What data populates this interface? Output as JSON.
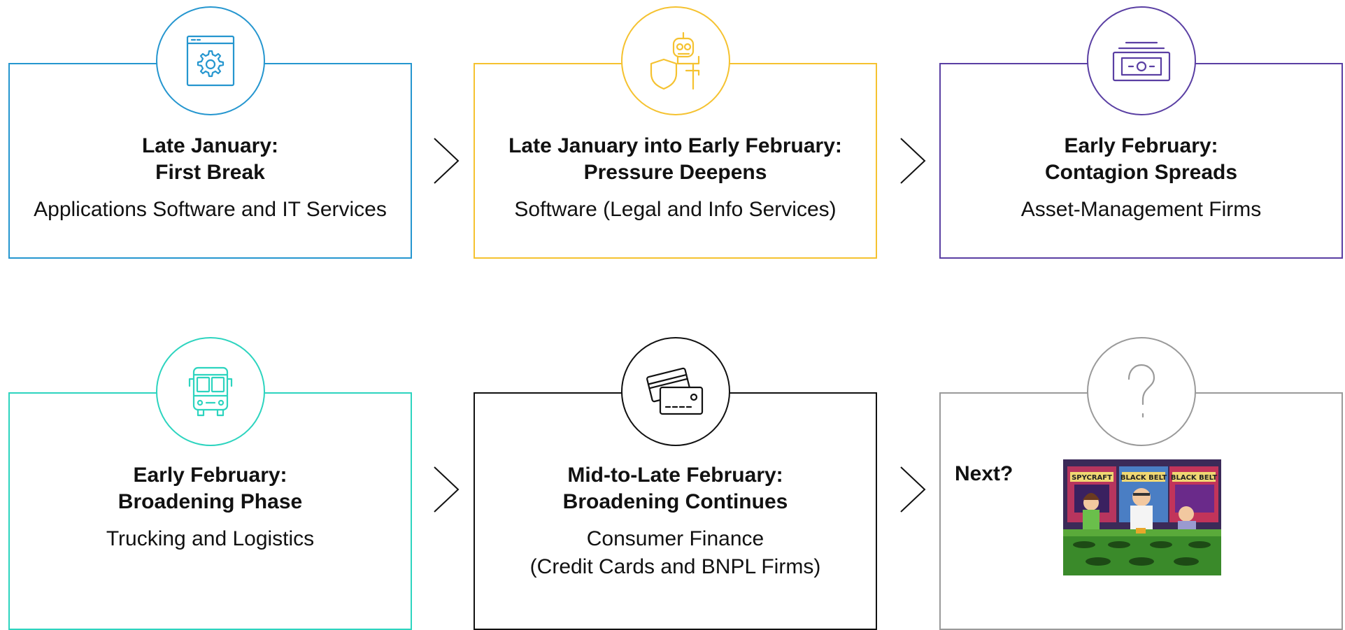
{
  "colors": {
    "blue": "#2596cf",
    "yellow": "#f5c230",
    "purple": "#5a3fa3",
    "teal": "#2dd4bf",
    "black": "#111111",
    "gray": "#9a9a9a"
  },
  "stages": [
    {
      "title_line1": "Late January:",
      "title_line2": "First Break",
      "subtitle": "Applications Software and IT Services",
      "icon": "browser-gear-icon"
    },
    {
      "title_line1": "Late January into Early February:",
      "title_line2": "Pressure Deepens",
      "subtitle": "Software (Legal and Info Services)",
      "icon": "robot-shield-icon"
    },
    {
      "title_line1": "Early February:",
      "title_line2": "Contagion Spreads",
      "subtitle": "Asset-Management Firms",
      "icon": "banknote-stack-icon"
    },
    {
      "title_line1": "Early February:",
      "title_line2": "Broadening Phase",
      "subtitle": "Trucking and Logistics",
      "icon": "bus-icon"
    },
    {
      "title_line1": "Mid-to-Late February:",
      "title_line2": "Broadening Continues",
      "subtitle_line1": "Consumer Finance",
      "subtitle_line2": "(Credit Cards and BNPL Firms)",
      "icon": "credit-cards-icon"
    },
    {
      "label": "Next?",
      "icon": "question-mark-icon",
      "image_sign_left": "SPYCRAFT",
      "image_sign_mid": "BLACK BELT",
      "image_sign_right": "BLACK BELT"
    }
  ]
}
